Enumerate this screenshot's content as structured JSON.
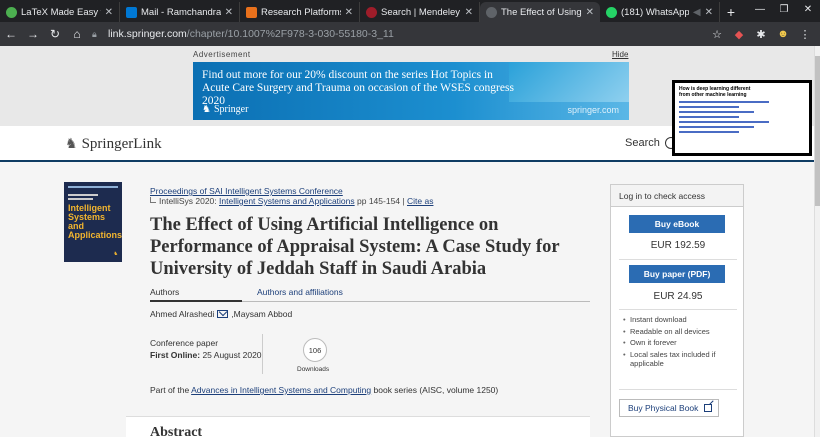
{
  "browser": {
    "tabs": [
      {
        "title": "LaTeX Made Easy with Ove",
        "color": "#4caf50"
      },
      {
        "title": "Mail - Ramchandra Mangrv",
        "color": "#0078d4"
      },
      {
        "title": "Research Platforms | Scopus",
        "color": "#e9711c"
      },
      {
        "title": "Search | Mendeley",
        "color": "#9e1d2a"
      },
      {
        "title": "The Effect of Using Artific",
        "color": "#5f6368"
      },
      {
        "title": "(181) WhatsApp",
        "color": "#25d366"
      }
    ],
    "url_host": "link.springer.com",
    "url_path": "/chapter/10.1007%2F978-3-030-55180-3_11"
  },
  "ad": {
    "label": "Advertisement",
    "hide": "Hide",
    "text": "Find out more for our 20% discount on the series Hot Topics in Acute Care Surgery and Trauma on occasion of the WSES congress 2020",
    "brand": "Springer",
    "url": "springer.com"
  },
  "pip": {
    "title": "How is deep learning different from other machine learning"
  },
  "header": {
    "logo_main": "Springer",
    "logo_link": "Link",
    "search": "Search"
  },
  "book": {
    "cover_title": "Intelligent Systems and Applications"
  },
  "article": {
    "crumb_proceedings": "Proceedings of SAI Intelligent Systems Conference",
    "crumb_conf_prefix": "IntelliSys 2020:",
    "crumb_conf_link": "Intelligent Systems and Applications",
    "crumb_pages": "pp 145-154 |",
    "crumb_cite": "Cite as",
    "title": "The Effect of Using Artificial Intelligence on Performance of Appraisal System: A Case Study for University of Jeddah Staff in Saudi Arabia",
    "tab_authors": "Authors",
    "tab_affiliations": "Authors and affiliations",
    "author1": "Ahmed Alrashedi",
    "author_sep": ", ",
    "author2": "Maysam Abbod",
    "type": "Conference paper",
    "first_online_label": "First Online:",
    "first_online_date": "25 August 2020",
    "downloads_count": "106",
    "downloads_label": "Downloads",
    "part_prefix": "Part of the",
    "part_link": "Advances in Intelligent Systems and Computing",
    "part_suffix": "book series (AISC, volume 1250)",
    "abstract_heading": "Abstract"
  },
  "sidebar": {
    "header": "Log in to check access",
    "buy_ebook": "Buy eBook",
    "ebook_price": "EUR 192.59",
    "buy_paper": "Buy paper (PDF)",
    "paper_price": "EUR 24.95",
    "perks": [
      "Instant download",
      "Readable on all devices",
      "Own it forever",
      "Local sales tax included if applicable"
    ],
    "buy_physical": "Buy Physical Book"
  }
}
